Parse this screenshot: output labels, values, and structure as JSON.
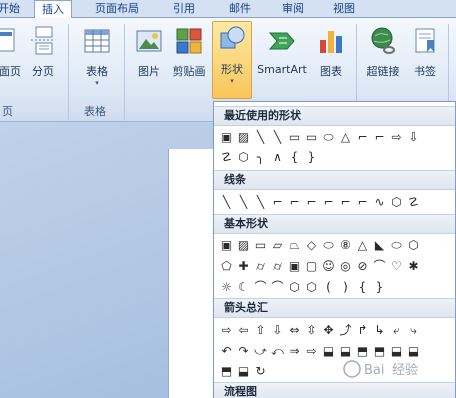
{
  "tabs": [
    "开始",
    "插入",
    "页面布局",
    "引用",
    "邮件",
    "审阅",
    "视图"
  ],
  "active_tab": "插入",
  "ribbon": {
    "pages_group": {
      "button_cover": "封面页",
      "button_break": "分页",
      "label": "页"
    },
    "table_group": {
      "button": "表格",
      "label": "表格"
    },
    "illustrations": {
      "picture": "图片",
      "clipart": "剪贴画",
      "shapes": "形状",
      "smartart": "SmartArt",
      "chart": "图表"
    },
    "links": {
      "hyperlink": "超链接",
      "bookmark": "书签"
    },
    "dropdown_arrow": "▾"
  },
  "dropdown": {
    "sections": [
      {
        "title": "最近使用的形状",
        "rows": [
          [
            "▣",
            "▨",
            "╲",
            "╲",
            "▭",
            "▭",
            "⬭",
            "△",
            "⌐",
            "⌐",
            "⇨",
            "⇩"
          ],
          [
            "☡",
            "⬡",
            "╮",
            "∧",
            "{",
            "}"
          ]
        ]
      },
      {
        "title": "线条",
        "rows": [
          [
            "╲",
            "╲",
            "╲",
            "⌐",
            "⌐",
            "⌐",
            "⌐",
            "⌐",
            "⌐",
            "∿",
            "⬡",
            "☡"
          ]
        ]
      },
      {
        "title": "基本形状",
        "rows": [
          [
            "▣",
            "▨",
            "▭",
            "▱",
            "⏢",
            "◇",
            "⬭",
            "⑧",
            "△",
            "◣",
            "⬭",
            "⬡"
          ],
          [
            "⬠",
            "✚",
            "⌭",
            "⌭",
            "▣",
            "▢",
            "☺",
            "◎",
            "⊘",
            "⌒",
            "♡",
            "✱"
          ],
          [
            "☼",
            "☾",
            "⌒",
            "⌒",
            "⬡",
            "⬡",
            "(",
            ")",
            "{",
            "}"
          ]
        ]
      },
      {
        "title": "箭头总汇",
        "rows": [
          [
            "⇨",
            "⇦",
            "⇧",
            "⇩",
            "⇔",
            "⇳",
            "✥",
            "⤴",
            "↱",
            "↳",
            "⤶",
            "⤷"
          ],
          [
            "↶",
            "↷",
            "⤻",
            "⤺",
            "⇒",
            "⇨",
            "⬓",
            "⬓",
            "⬒",
            "⬒",
            "⬓",
            "⬓"
          ],
          [
            "⬒",
            "⬓",
            "↻"
          ]
        ]
      },
      {
        "title": "流程图",
        "rows": []
      }
    ]
  },
  "watermark_text": "Baidu 经验"
}
